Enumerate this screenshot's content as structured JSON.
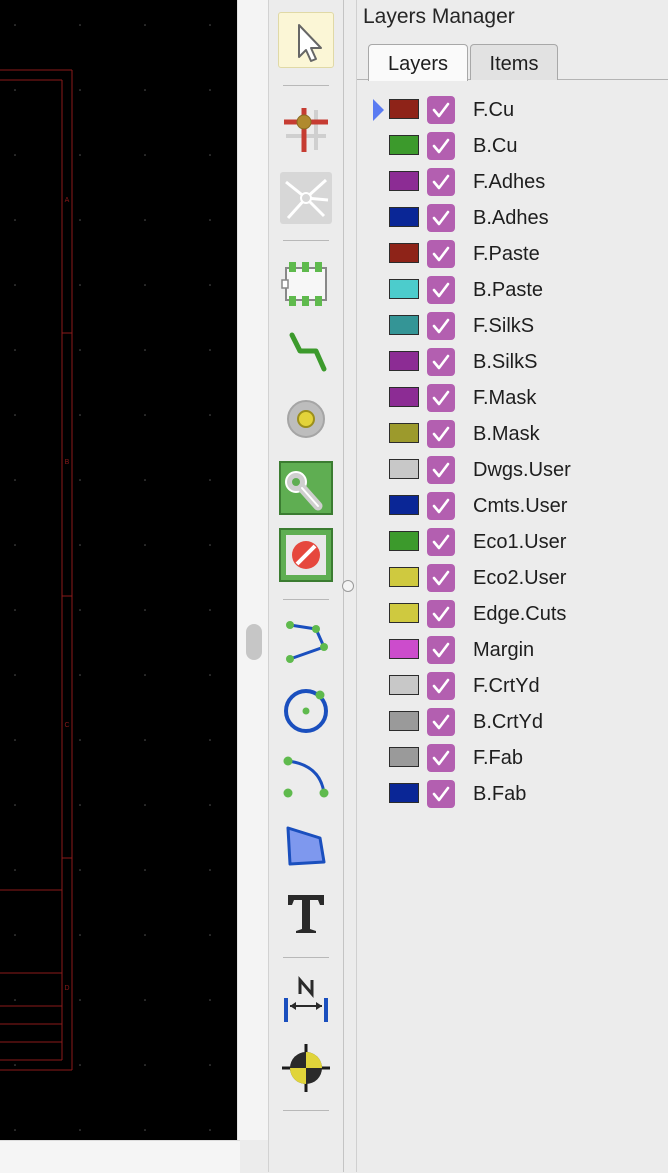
{
  "canvas": {
    "background": "#000000",
    "border_color": "#8b1a1a",
    "zone_letters": [
      "A",
      "B",
      "C",
      "D"
    ]
  },
  "toolbar": {
    "tools": [
      {
        "name": "select-tool",
        "icon": "arrow-cursor-icon",
        "active": true
      },
      {
        "name": "highlight-net-tool",
        "icon": "net-highlight-icon"
      },
      {
        "name": "local-ratsnest-tool",
        "icon": "ratsnest-icon"
      },
      {
        "name": "add-footprint-tool",
        "icon": "footprint-icon"
      },
      {
        "name": "route-track-tool",
        "icon": "route-track-icon"
      },
      {
        "name": "add-via-tool",
        "icon": "via-icon"
      },
      {
        "name": "add-zone-tool",
        "icon": "zone-icon"
      },
      {
        "name": "add-keepout-tool",
        "icon": "keepout-icon"
      },
      {
        "name": "draw-line-tool",
        "icon": "line-icon"
      },
      {
        "name": "draw-circle-tool",
        "icon": "circle-icon"
      },
      {
        "name": "draw-arc-tool",
        "icon": "arc-icon"
      },
      {
        "name": "draw-polygon-tool",
        "icon": "polygon-icon"
      },
      {
        "name": "add-text-tool",
        "icon": "text-icon"
      },
      {
        "name": "add-dimension-tool",
        "icon": "dimension-icon"
      },
      {
        "name": "place-target-tool",
        "icon": "target-icon"
      }
    ]
  },
  "layers_manager": {
    "title": "Layers Manager",
    "tabs": {
      "layers": "Layers",
      "items": "Items"
    },
    "active_tab": "Layers",
    "selected_layer": "F.Cu",
    "layers": [
      {
        "name": "F.Cu",
        "color": "#8e2318",
        "visible": true
      },
      {
        "name": "B.Cu",
        "color": "#3c9a2c",
        "visible": true
      },
      {
        "name": "F.Adhes",
        "color": "#8c2c94",
        "visible": true
      },
      {
        "name": "B.Adhes",
        "color": "#0a2696",
        "visible": true
      },
      {
        "name": "F.Paste",
        "color": "#8e2318",
        "visible": true
      },
      {
        "name": "B.Paste",
        "color": "#4ccccc",
        "visible": true
      },
      {
        "name": "F.SilkS",
        "color": "#349596",
        "visible": true
      },
      {
        "name": "B.SilkS",
        "color": "#8c2c94",
        "visible": true
      },
      {
        "name": "F.Mask",
        "color": "#8c2c94",
        "visible": true
      },
      {
        "name": "B.Mask",
        "color": "#9c9a2c",
        "visible": true
      },
      {
        "name": "Dwgs.User",
        "color": "#c8c8c8",
        "visible": true
      },
      {
        "name": "Cmts.User",
        "color": "#0a2696",
        "visible": true
      },
      {
        "name": "Eco1.User",
        "color": "#3c9a2c",
        "visible": true
      },
      {
        "name": "Eco2.User",
        "color": "#cfc93f",
        "visible": true
      },
      {
        "name": "Edge.Cuts",
        "color": "#cfc93f",
        "visible": true
      },
      {
        "name": "Margin",
        "color": "#cc4ccc",
        "visible": true
      },
      {
        "name": "F.CrtYd",
        "color": "#c8c8c8",
        "visible": true
      },
      {
        "name": "B.CrtYd",
        "color": "#9a9a9a",
        "visible": true
      },
      {
        "name": "F.Fab",
        "color": "#9a9a9a",
        "visible": true
      },
      {
        "name": "B.Fab",
        "color": "#0a2696",
        "visible": true
      }
    ]
  }
}
